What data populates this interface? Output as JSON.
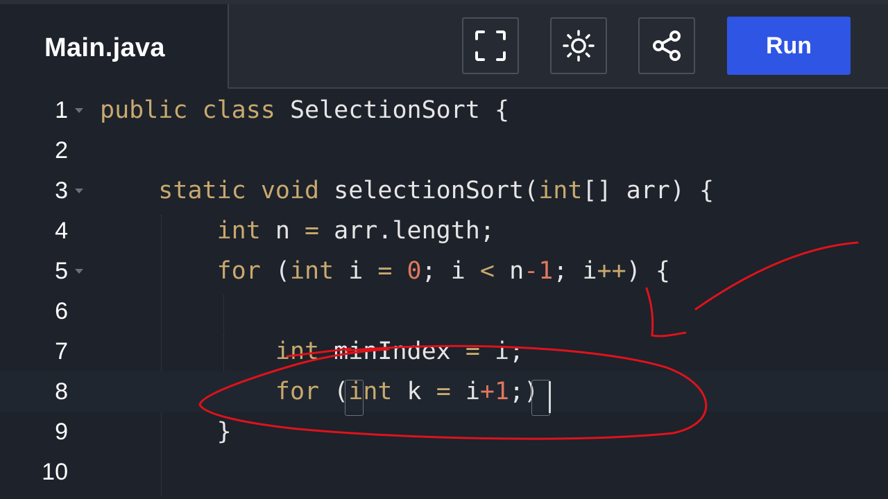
{
  "tab": {
    "title": "Main.java"
  },
  "toolbar": {
    "buttons": [
      {
        "name": "fullscreen-button",
        "icon": "fullscreen-icon"
      },
      {
        "name": "theme-toggle-button",
        "icon": "sun-icon"
      },
      {
        "name": "share-button",
        "icon": "share-icon"
      }
    ],
    "run_label": "Run",
    "run_color": "#2f55e5"
  },
  "editor": {
    "lines": [
      {
        "num": "1",
        "tokens": [
          [
            "public",
            "kw"
          ],
          [
            " ",
            ""
          ],
          [
            "class",
            "kw"
          ],
          [
            " SelectionSort {",
            ""
          ]
        ]
      },
      {
        "num": "2",
        "tokens": []
      },
      {
        "num": "3",
        "tokens": [
          [
            "    ",
            ""
          ],
          [
            "static",
            "kw"
          ],
          [
            " ",
            ""
          ],
          [
            "void",
            "kw"
          ],
          [
            " selectionSort(",
            ""
          ],
          [
            "int",
            "kw"
          ],
          [
            "[] arr) {",
            ""
          ]
        ]
      },
      {
        "num": "4",
        "tokens": [
          [
            "        ",
            ""
          ],
          [
            "int",
            "kw"
          ],
          [
            " n ",
            ""
          ],
          [
            "=",
            "kw"
          ],
          [
            " arr.length;",
            ""
          ]
        ]
      },
      {
        "num": "5",
        "tokens": [
          [
            "        ",
            ""
          ],
          [
            "for",
            "kw"
          ],
          [
            " (",
            ""
          ],
          [
            "int",
            "kw"
          ],
          [
            " i ",
            ""
          ],
          [
            "=",
            "kw"
          ],
          [
            " ",
            ""
          ],
          [
            "0",
            "num"
          ],
          [
            "; i ",
            ""
          ],
          [
            "<",
            "kw"
          ],
          [
            " n",
            ""
          ],
          [
            "-1",
            "num"
          ],
          [
            "; i",
            ""
          ],
          [
            "++",
            "kw"
          ],
          [
            ") {",
            ""
          ]
        ]
      },
      {
        "num": "6",
        "tokens": []
      },
      {
        "num": "7",
        "tokens": [
          [
            "            ",
            ""
          ],
          [
            "int",
            "kw"
          ],
          [
            " minIndex ",
            ""
          ],
          [
            "=",
            "kw"
          ],
          [
            " i;",
            ""
          ]
        ]
      },
      {
        "num": "8",
        "tokens": [
          [
            "            ",
            ""
          ],
          [
            "for",
            "kw"
          ],
          [
            " (",
            ""
          ],
          [
            "int",
            "kw"
          ],
          [
            " k ",
            ""
          ],
          [
            "=",
            "kw"
          ],
          [
            " i",
            ""
          ],
          [
            "+1",
            "num"
          ],
          [
            ";)",
            ""
          ]
        ]
      },
      {
        "num": "9",
        "tokens": [
          [
            "        }",
            ""
          ]
        ]
      },
      {
        "num": "10",
        "tokens": []
      }
    ],
    "colors": {
      "keyword": "#c9a96e",
      "number": "#e0785c",
      "text": "#e6e6e6",
      "background": "#1d222b"
    }
  }
}
